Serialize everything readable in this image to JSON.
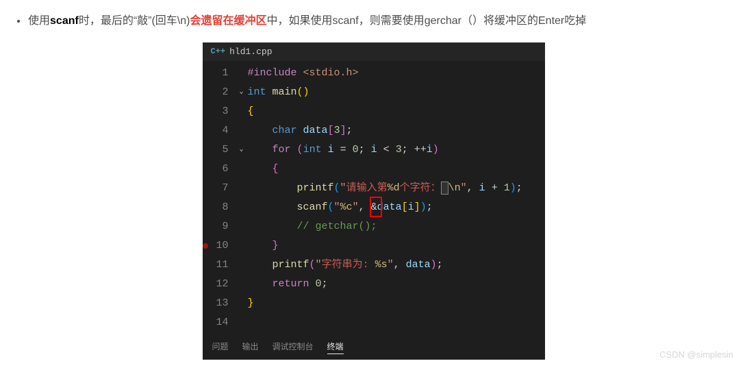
{
  "bullet": {
    "pre": "使用",
    "scanf": "scanf",
    "mid1": "时，最后的“敲”(回车\\n)",
    "red": "会遗留在缓冲区",
    "mid2": "中，如果使用scanf，则需要使用gerchar（）将缓冲区的Enter吃掉"
  },
  "tab": {
    "icon": "C++",
    "filename": "hld1.cpp"
  },
  "code": {
    "lines": [
      "1",
      "2",
      "3",
      "4",
      "5",
      "6",
      "7",
      "8",
      "9",
      "10",
      "11",
      "12",
      "13",
      "14"
    ],
    "l1_include": "#include",
    "l1_path": " <stdio.h>",
    "l2_int": "int",
    "l2_main": "main",
    "l2_paren": "()",
    "l3_brace": "{",
    "l4_char": "char",
    "l4_data": "data",
    "l4_arr_open": "[",
    "l4_3": "3",
    "l4_arr_close": "]",
    "l5_for": "for",
    "l5_po": "(",
    "l5_int": "int",
    "l5_i": "i",
    "l5_eq": " = ",
    "l5_0": "0",
    "l5_sc": "; ",
    "l5_i2": "i",
    "l5_lt": " < ",
    "l5_3": "3",
    "l5_sc2": "; ",
    "l5_inc": "++",
    "l5_i3": "i",
    "l5_pc": ")",
    "l6_brace": "{",
    "l7_printf": "printf",
    "l7_po": "(",
    "l7_q": "\"",
    "l7_zh": "请输入第",
    "l7_fmt": "%d",
    "l7_zh2": "个字符：",
    "l7_esc": "\\n",
    "l7_q2": "\"",
    "l7_c": ", ",
    "l7_i": "i",
    "l7_plus": " + ",
    "l7_1": "1",
    "l7_pc": ")",
    "l8_scanf": "scanf",
    "l8_po": "(",
    "l8_q": "\"",
    "l8_fmt": "%c",
    "l8_q2": "\"",
    "l8_c": ", ",
    "l8_amp": "&",
    "l8_data": "data",
    "l8_bo": "[",
    "l8_i": "i",
    "l8_bc": "]",
    "l8_pc": ")",
    "l9_comment": "// getchar();",
    "l10_brace": "}",
    "l11_printf": "printf",
    "l11_po": "(",
    "l11_q": "\"",
    "l11_zh": "字符串为: ",
    "l11_fmt": "%s",
    "l11_q2": "\"",
    "l11_c": ", ",
    "l11_data": "data",
    "l11_pc": ")",
    "l12_return": "return",
    "l12_0": "0",
    "l13_brace": "}"
  },
  "bottom_tabs": {
    "t1": "问题",
    "t2": "输出",
    "t3": "调试控制台",
    "t4": "终端"
  },
  "watermark": "CSDN @simplesin"
}
